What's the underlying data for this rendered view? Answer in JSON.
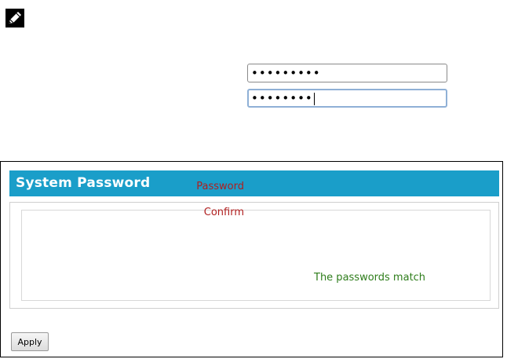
{
  "note": {
    "icon": "pencil-note-icon"
  },
  "panel": {
    "title": "System Password",
    "header_color": "#1a9ec9"
  },
  "form": {
    "password_label": "Password",
    "password_value": "•••••••••",
    "confirm_label": "Confirm",
    "confirm_value": "••••••••",
    "match_message": "The passwords match",
    "label_color": "#b01e1e",
    "match_color": "#2e7d1b"
  },
  "actions": {
    "apply_label": "Apply"
  }
}
